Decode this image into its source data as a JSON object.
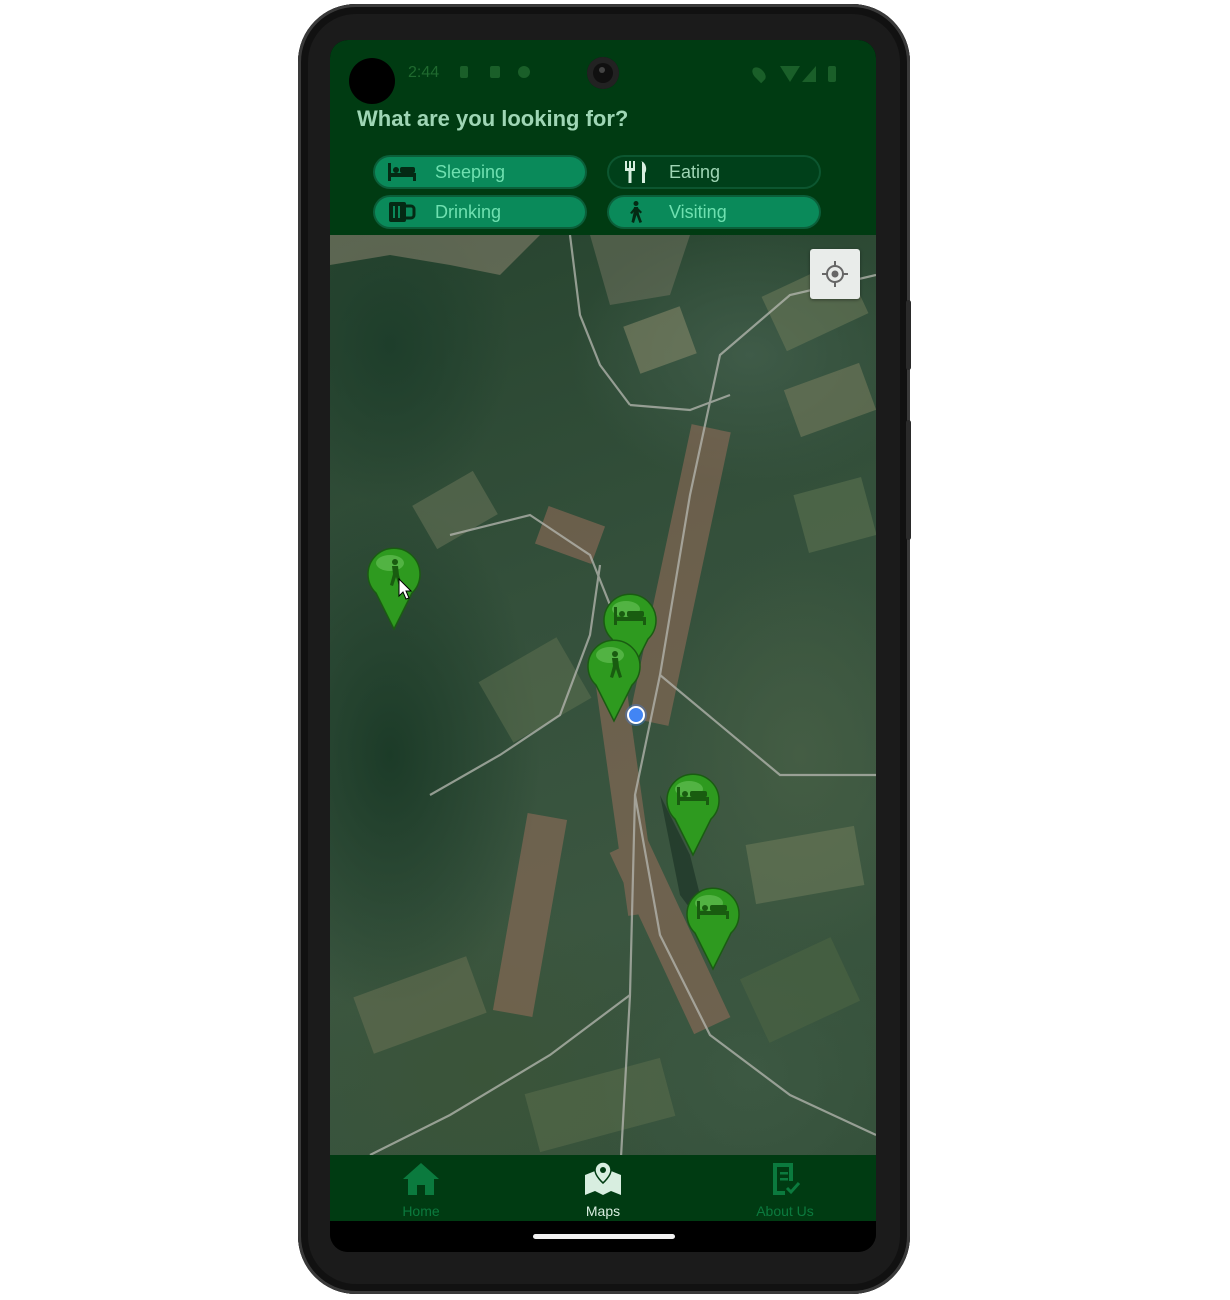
{
  "status_bar": {
    "time": "2:44"
  },
  "header": {
    "question": "What are you looking for?"
  },
  "filters": [
    {
      "label": "Sleeping",
      "icon": "bed-icon",
      "selected": true
    },
    {
      "label": "Eating",
      "icon": "fork-knife-icon",
      "selected": false
    },
    {
      "label": "Drinking",
      "icon": "beer-mug-icon",
      "selected": true
    },
    {
      "label": "Visiting",
      "icon": "walking-person-icon",
      "selected": true
    }
  ],
  "map": {
    "view": "satellite",
    "markers": [
      {
        "category": "Visiting",
        "icon": "walking-person-icon"
      },
      {
        "category": "Sleeping",
        "icon": "bed-icon"
      },
      {
        "category": "Visiting",
        "icon": "walking-person-icon"
      },
      {
        "category": "Sleeping",
        "icon": "bed-icon"
      },
      {
        "category": "Sleeping",
        "icon": "bed-icon"
      }
    ],
    "locate_button_icon": "crosshair-icon"
  },
  "nav": {
    "items": [
      {
        "label": "Home",
        "icon": "home-icon",
        "active": false
      },
      {
        "label": "Maps",
        "icon": "map-pin-icon",
        "active": true
      },
      {
        "label": "About Us",
        "icon": "document-check-icon",
        "active": false
      }
    ]
  },
  "colors": {
    "header_bg": "#003b12",
    "chip_selected": "#0a8a5a",
    "chip_unselected": "#00401a",
    "marker_green": "#2e9a1f",
    "user_location": "#4285f4"
  }
}
